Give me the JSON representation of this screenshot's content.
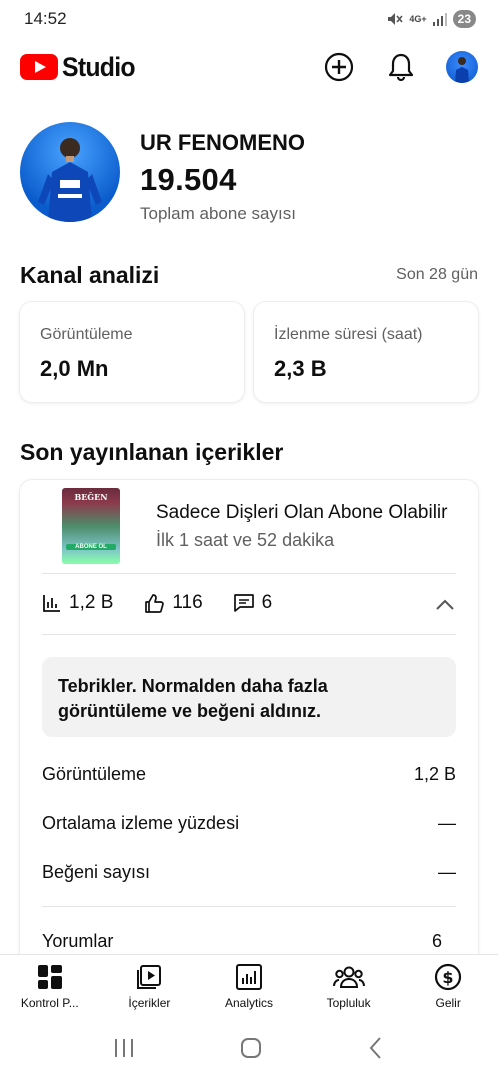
{
  "status_bar": {
    "time": "14:52",
    "network": "4G+",
    "battery": "23"
  },
  "app": {
    "logo_text": "Studio"
  },
  "channel": {
    "name": "UR FENOMENO",
    "subscriber_count": "19.504",
    "subscriber_label": "Toplam abone sayısı"
  },
  "analytics": {
    "title": "Kanal analizi",
    "period": "Son 28 gün",
    "cards": [
      {
        "label": "Görüntüleme",
        "value": "2,0 Mn"
      },
      {
        "label": "İzlenme süresi (saat)",
        "value": "2,3 B"
      }
    ]
  },
  "recent": {
    "title": "Son yayınlanan içerikler",
    "video": {
      "thumbnail_text_top": "BEĞEN",
      "thumbnail_text_bottom": "ABONE OL",
      "title": "Sadece Dişleri Olan Abone Olabilir",
      "subtitle": "İlk 1 saat ve 52 dakika",
      "views": "1,2 B",
      "likes": "116",
      "comments": "6"
    },
    "message": "Tebrikler. Normalden daha fazla görüntüleme ve beğeni aldınız.",
    "metrics": [
      {
        "label": "Görüntüleme",
        "value": "1,2 B"
      },
      {
        "label": "Ortalama izleme yüzdesi",
        "value": "—"
      },
      {
        "label": "Beğeni sayısı",
        "value": "—"
      },
      {
        "label": "Yorumlar",
        "value": "6"
      }
    ]
  },
  "bottom_nav": [
    {
      "label": "Kontrol P...",
      "icon": "dashboard-icon"
    },
    {
      "label": "İçerikler",
      "icon": "content-icon"
    },
    {
      "label": "Analytics",
      "icon": "analytics-icon"
    },
    {
      "label": "Topluluk",
      "icon": "community-icon"
    },
    {
      "label": "Gelir",
      "icon": "earn-icon"
    }
  ]
}
